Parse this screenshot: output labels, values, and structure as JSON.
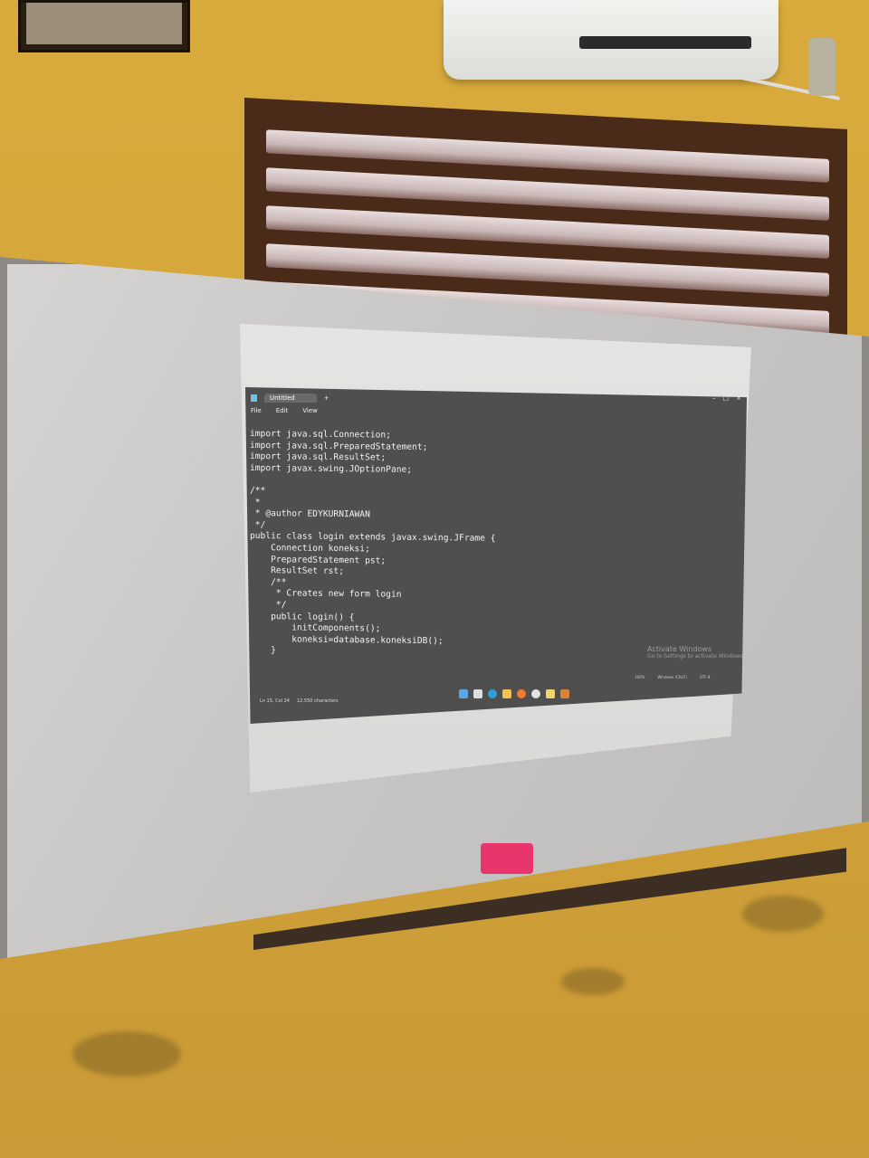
{
  "window": {
    "tab_title": "Untitled",
    "new_tab": "+",
    "controls": [
      "–",
      "□",
      "×"
    ],
    "menu": [
      "File",
      "Edit",
      "View"
    ]
  },
  "code_lines": [
    "import java.sql.Connection;",
    "import java.sql.PreparedStatement;",
    "import java.sql.ResultSet;",
    "import javax.swing.JOptionPane;",
    "",
    "/**",
    " *",
    " * @author EDYKURNIAWAN",
    " */",
    "public class login extends javax.swing.JFrame {",
    "    Connection koneksi;",
    "    PreparedStatement pst;",
    "    ResultSet rst;",
    "    /**",
    "     * Creates new form login",
    "     */",
    "    public login() {",
    "        initComponents();",
    "        koneksi=database.koneksiDB();",
    "    }"
  ],
  "watermark": {
    "title": "Activate Windows",
    "subtitle": "Go to Settings to activate Windows."
  },
  "status_bar": {
    "position": "Ln 15, Col 24",
    "characters": "12,550 characters",
    "zoom": "100%",
    "line_ending": "Windows (CRLF)",
    "encoding": "UTF-8"
  },
  "colors": {
    "editor_bg": "#4f4f50",
    "eraser": "#e8356c",
    "wall": "#d4a53a"
  },
  "taskbar_icons": [
    "start-icon",
    "search-icon",
    "edge-icon",
    "explorer-icon",
    "firefox-icon",
    "chrome-icon",
    "notepad-icon",
    "app-icon"
  ]
}
